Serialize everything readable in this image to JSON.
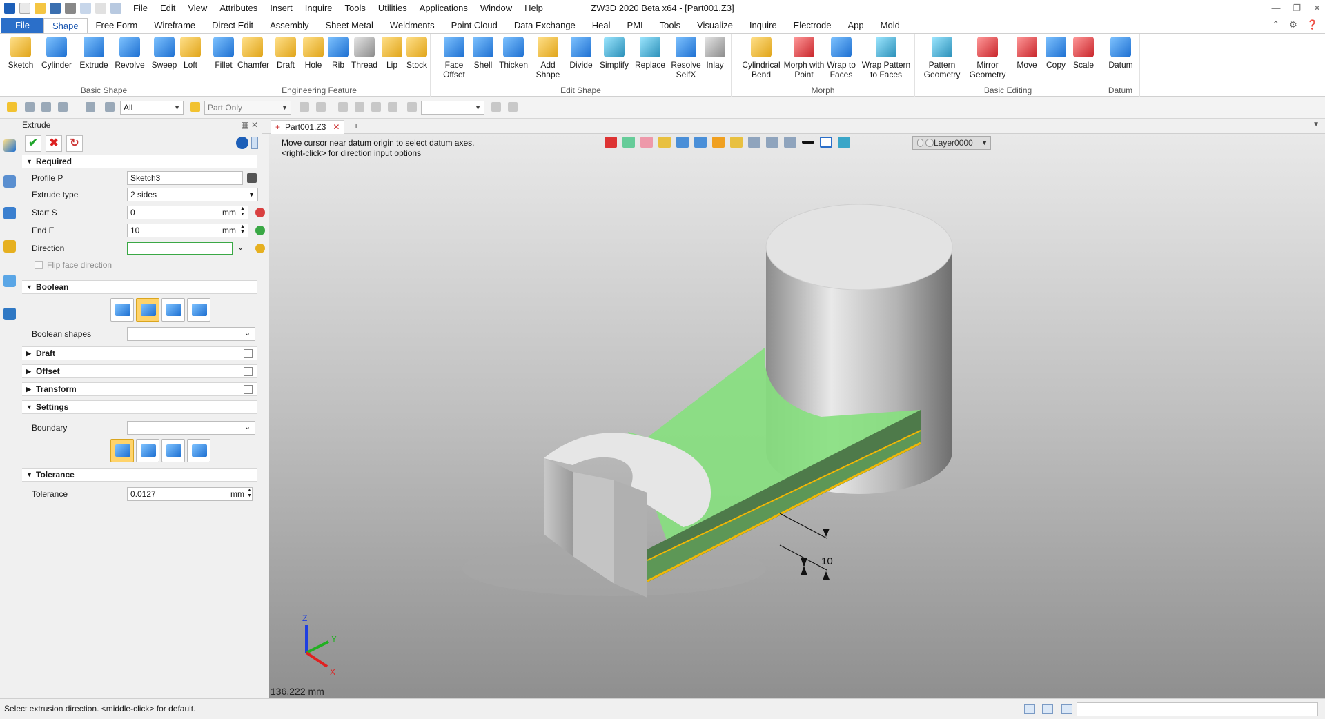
{
  "window": {
    "title": "ZW3D 2020 Beta x64 - [Part001.Z3]",
    "menu": [
      "File",
      "Edit",
      "View",
      "Attributes",
      "Insert",
      "Inquire",
      "Tools",
      "Utilities",
      "Applications",
      "Window",
      "Help"
    ]
  },
  "ribbon_tabs": [
    "File",
    "Shape",
    "Free Form",
    "Wireframe",
    "Direct Edit",
    "Assembly",
    "Sheet Metal",
    "Weldments",
    "Point Cloud",
    "Data Exchange",
    "Heal",
    "PMI",
    "Tools",
    "Visualize",
    "Inquire",
    "Electrode",
    "App",
    "Mold"
  ],
  "ribbon": {
    "basic_shape": {
      "label": "Basic Shape",
      "buttons": [
        "Sketch",
        "Cylinder",
        "Extrude",
        "Revolve",
        "Sweep",
        "Loft"
      ]
    },
    "engineering_feature": {
      "label": "Engineering Feature",
      "buttons": [
        "Fillet",
        "Chamfer",
        "Draft",
        "Hole",
        "Rib",
        "Thread",
        "Lip",
        "Stock"
      ]
    },
    "edit_shape": {
      "label": "Edit Shape",
      "buttons": [
        "Face Offset",
        "Shell",
        "Thicken",
        "Add Shape",
        "Divide",
        "Simplify",
        "Replace",
        "Resolve SelfX",
        "Inlay"
      ]
    },
    "morph": {
      "label": "Morph",
      "buttons": [
        "Cylindrical Bend",
        "Morph with Point",
        "Wrap to Faces",
        "Wrap Pattern to Faces"
      ]
    },
    "basic_editing": {
      "label": "Basic Editing",
      "buttons": [
        "Pattern Geometry",
        "Mirror Geometry",
        "Move",
        "Copy",
        "Scale"
      ]
    },
    "datum": {
      "label": "Datum",
      "buttons": [
        "Datum"
      ]
    }
  },
  "toolbar2": {
    "filter_value": "All",
    "scope_value": "Part Only"
  },
  "panel": {
    "title": "Extrude",
    "sections": {
      "required": "Required",
      "boolean": "Boolean",
      "draft": "Draft",
      "offset": "Offset",
      "transform": "Transform",
      "settings": "Settings",
      "tolerance": "Tolerance"
    },
    "fields": {
      "profile_label": "Profile P",
      "profile_value": "Sketch3",
      "extrude_type_label": "Extrude type",
      "extrude_type_value": "2 sides",
      "start_label": "Start S",
      "start_value": "0",
      "end_label": "End E",
      "end_value": "10",
      "unit": "mm",
      "direction_label": "Direction",
      "direction_value": "",
      "flip_label": "Flip face direction",
      "boolean_shapes_label": "Boolean shapes",
      "boolean_shapes_value": "",
      "boundary_label": "Boundary",
      "boundary_value": "",
      "tolerance_label": "Tolerance",
      "tolerance_value": "0.0127"
    }
  },
  "document_tab": "Part001.Z3",
  "viewport": {
    "prompt_line1": "Move cursor near datum origin to select datum axes.",
    "prompt_line2": "<right-click> for direction input options",
    "layer": "Layer0000",
    "dimension_label": "10",
    "scale": "136.222 mm",
    "axes": {
      "x": "X",
      "y": "Y",
      "z": "Z"
    }
  },
  "status": {
    "text": "Select extrusion direction.  <middle-click> for default."
  },
  "colors": {
    "accent": "#2b6fc9",
    "selection": "#7ee07a",
    "edge_highlight": "#f2b705"
  }
}
